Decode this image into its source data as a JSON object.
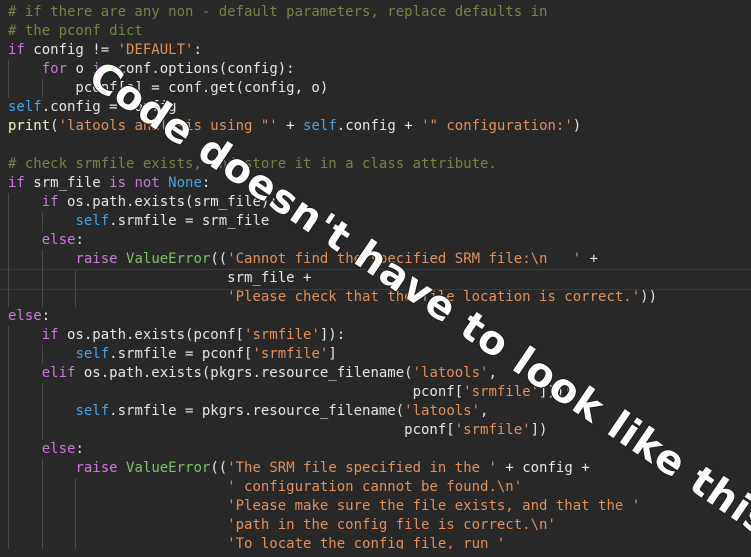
{
  "watermark": "Code doesn't have to look like this!",
  "colors": {
    "background": "#282828",
    "comment": "#75864a",
    "keyword": "#cc7bdc",
    "string": "#e2915f",
    "self": "#4aa3e0",
    "class": "#7fc26a",
    "text": "#e6e6e6"
  },
  "code_lines": [
    [
      [
        "c-comment",
        "# if there are any non - default parameters, replace defaults in"
      ]
    ],
    [
      [
        "c-comment",
        "# the pconf dict"
      ]
    ],
    [
      [
        "c-kw",
        "if"
      ],
      [
        "c-name",
        " config "
      ],
      [
        "c-op",
        "!="
      ],
      [
        "c-name",
        " "
      ],
      [
        "c-string",
        "'DEFAULT'"
      ],
      [
        "c-op",
        ":"
      ]
    ],
    [
      [
        "c-name",
        "    "
      ],
      [
        "c-kw",
        "for"
      ],
      [
        "c-name",
        " o "
      ],
      [
        "c-kw",
        "in"
      ],
      [
        "c-name",
        " conf.options(config):"
      ]
    ],
    [
      [
        "c-name",
        "        pconf[o] = conf.get(config, o)"
      ]
    ],
    [
      [
        "c-selfkw",
        "self"
      ],
      [
        "c-name",
        ".config = config"
      ]
    ],
    [
      [
        "c-builtin",
        "print"
      ],
      [
        "c-name",
        "("
      ],
      [
        "c-string",
        "'latools analysis using \"'"
      ],
      [
        "c-name",
        " + "
      ],
      [
        "c-selfkw",
        "self"
      ],
      [
        "c-name",
        ".config + "
      ],
      [
        "c-string",
        "'\" configuration:'"
      ],
      [
        "c-name",
        ")"
      ]
    ],
    [
      [
        "c-name",
        ""
      ]
    ],
    [
      [
        "c-comment",
        "# check srmfile exists, and store it in a class attribute."
      ]
    ],
    [
      [
        "c-kw",
        "if"
      ],
      [
        "c-name",
        " srm_file "
      ],
      [
        "c-kw",
        "is not"
      ],
      [
        "c-name",
        " "
      ],
      [
        "c-const",
        "None"
      ],
      [
        "c-name",
        ":"
      ]
    ],
    [
      [
        "c-name",
        "    "
      ],
      [
        "c-kw",
        "if"
      ],
      [
        "c-name",
        " os.path.exists(srm_file):"
      ]
    ],
    [
      [
        "c-name",
        "        "
      ],
      [
        "c-selfkw",
        "self"
      ],
      [
        "c-name",
        ".srmfile = srm_file"
      ]
    ],
    [
      [
        "c-name",
        "    "
      ],
      [
        "c-kw",
        "else"
      ],
      [
        "c-name",
        ":"
      ]
    ],
    [
      [
        "c-name",
        "        "
      ],
      [
        "c-kw",
        "raise"
      ],
      [
        "c-name",
        " "
      ],
      [
        "c-class",
        "ValueError"
      ],
      [
        "c-name",
        "(("
      ],
      [
        "c-string",
        "'Cannot find the specified SRM file:\\n   '"
      ],
      [
        "c-name",
        " +"
      ]
    ],
    [
      [
        "c-name",
        "                          srm_file +"
      ]
    ],
    [
      [
        "c-name",
        "                          "
      ],
      [
        "c-string",
        "'Please check that the file location is correct.'"
      ],
      [
        "c-name",
        "))"
      ]
    ],
    [
      [
        "c-kw",
        "else"
      ],
      [
        "c-name",
        ":"
      ]
    ],
    [
      [
        "c-name",
        "    "
      ],
      [
        "c-kw",
        "if"
      ],
      [
        "c-name",
        " os.path.exists(pconf["
      ],
      [
        "c-string",
        "'srmfile'"
      ],
      [
        "c-name",
        "]):"
      ]
    ],
    [
      [
        "c-name",
        "        "
      ],
      [
        "c-selfkw",
        "self"
      ],
      [
        "c-name",
        ".srmfile = pconf["
      ],
      [
        "c-string",
        "'srmfile'"
      ],
      [
        "c-name",
        "]"
      ]
    ],
    [
      [
        "c-name",
        "    "
      ],
      [
        "c-kw",
        "elif"
      ],
      [
        "c-name",
        " os.path.exists(pkgrs.resource_filename("
      ],
      [
        "c-string",
        "'latools'"
      ],
      [
        "c-name",
        ","
      ]
    ],
    [
      [
        "c-name",
        "                                                pconf["
      ],
      [
        "c-string",
        "'srmfile'"
      ],
      [
        "c-name",
        "])):"
      ]
    ],
    [
      [
        "c-name",
        "        "
      ],
      [
        "c-selfkw",
        "self"
      ],
      [
        "c-name",
        ".srmfile = pkgrs.resource_filename("
      ],
      [
        "c-string",
        "'latools'"
      ],
      [
        "c-name",
        ","
      ]
    ],
    [
      [
        "c-name",
        "                                               pconf["
      ],
      [
        "c-string",
        "'srmfile'"
      ],
      [
        "c-name",
        "])"
      ]
    ],
    [
      [
        "c-name",
        "    "
      ],
      [
        "c-kw",
        "else"
      ],
      [
        "c-name",
        ":"
      ]
    ],
    [
      [
        "c-name",
        "        "
      ],
      [
        "c-kw",
        "raise"
      ],
      [
        "c-name",
        " "
      ],
      [
        "c-class",
        "ValueError"
      ],
      [
        "c-name",
        "(("
      ],
      [
        "c-string",
        "'The SRM file specified in the '"
      ],
      [
        "c-name",
        " + config +"
      ]
    ],
    [
      [
        "c-name",
        "                          "
      ],
      [
        "c-string",
        "' configuration cannot be found.\\n'"
      ]
    ],
    [
      [
        "c-name",
        "                          "
      ],
      [
        "c-string",
        "'Please make sure the file exists, and that the '"
      ]
    ],
    [
      [
        "c-name",
        "                          "
      ],
      [
        "c-string",
        "'path in the config file is correct.\\n'"
      ]
    ],
    [
      [
        "c-name",
        "                          "
      ],
      [
        "c-string",
        "'To locate the config file, run '"
      ]
    ]
  ]
}
